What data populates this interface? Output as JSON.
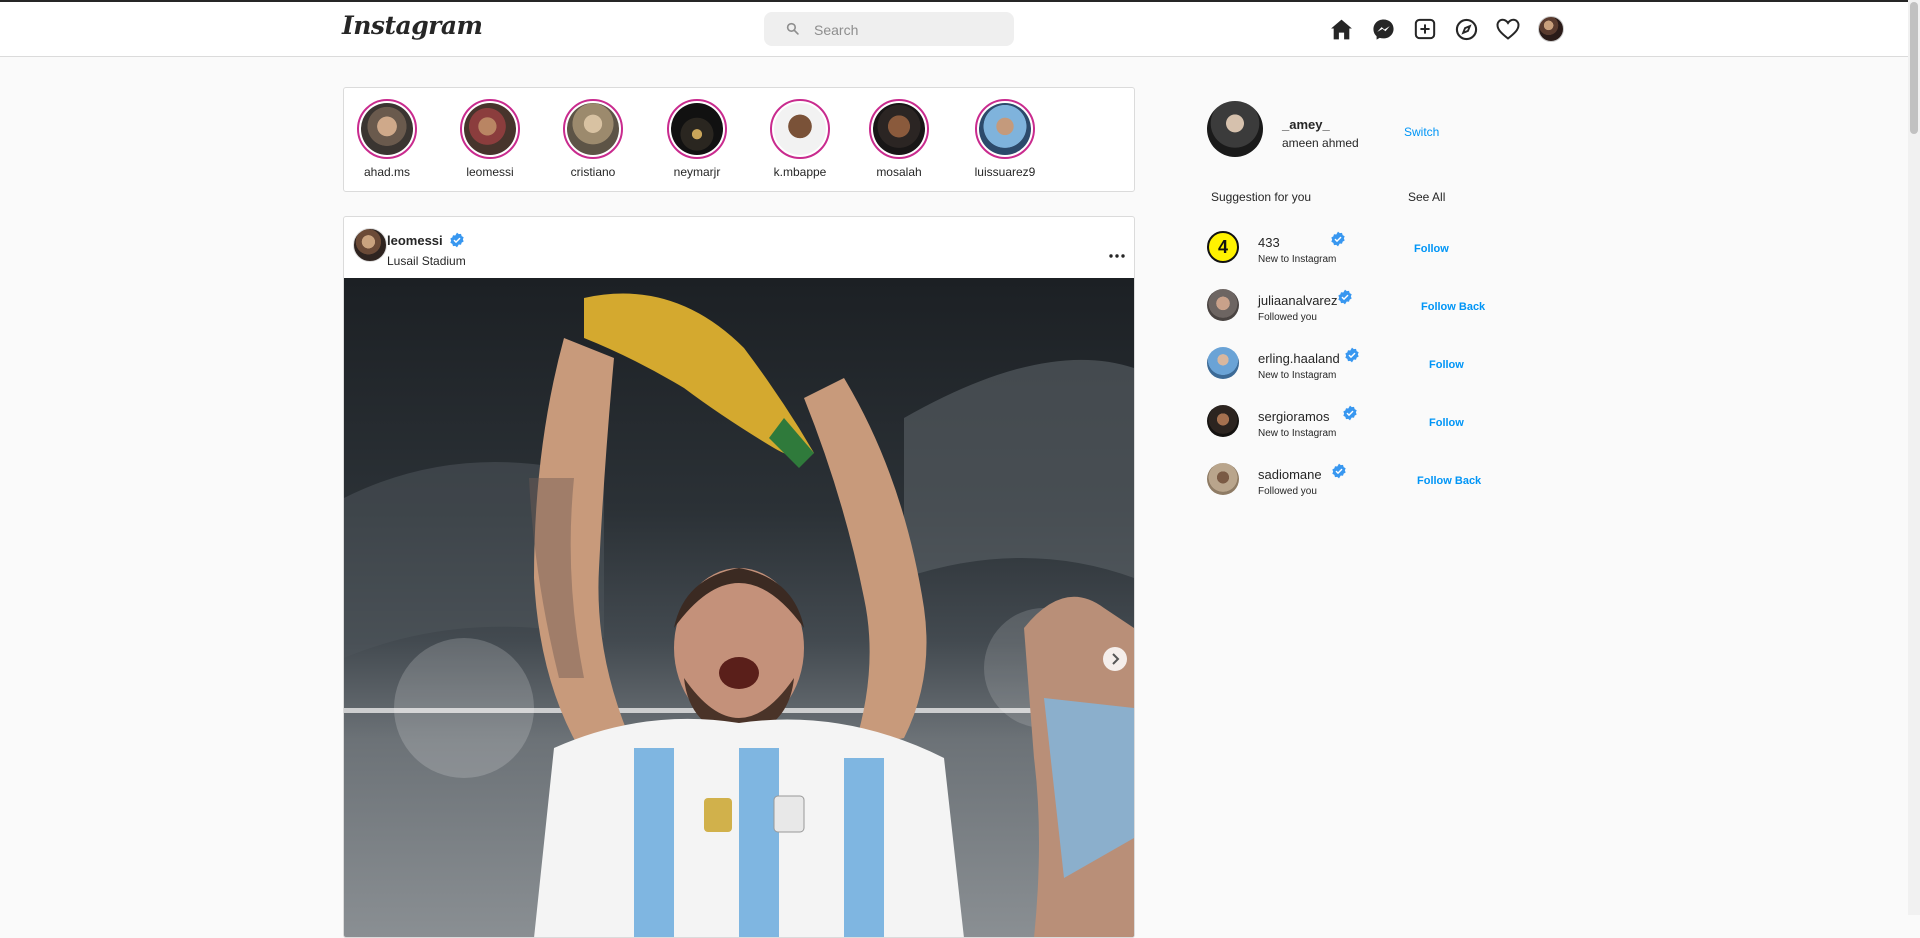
{
  "app": {
    "logo_text": "Instagram"
  },
  "search": {
    "placeholder": "Search"
  },
  "nav": {
    "icons": [
      "home-icon",
      "messenger-icon",
      "new-post-icon",
      "explore-icon",
      "activity-heart-icon",
      "profile-avatar"
    ]
  },
  "stories": [
    {
      "username": "ahad.ms"
    },
    {
      "username": "leomessi"
    },
    {
      "username": "cristiano"
    },
    {
      "username": "neymarjr"
    },
    {
      "username": "k.mbappe"
    },
    {
      "username": "mosalah"
    },
    {
      "username": "luissuarez9"
    }
  ],
  "post": {
    "username": "leomessi",
    "location": "Lusail Stadium",
    "verified": true
  },
  "profile": {
    "username": "_amey_",
    "full_name": "ameen ahmed",
    "switch_label": "Switch"
  },
  "suggestions": {
    "title": "Suggestion for you",
    "see_all_label": "See All",
    "items": [
      {
        "username": "433",
        "subtitle": "New to Instagram",
        "action": "Follow",
        "verified": true,
        "avatar_text": "4"
      },
      {
        "username": "juliaanalvarez",
        "subtitle": "Followed you",
        "action": "Follow Back",
        "verified": true
      },
      {
        "username": "erling.haaland",
        "subtitle": "New to Instagram",
        "action": "Follow",
        "verified": true
      },
      {
        "username": "sergioramos",
        "subtitle": "New to Instagram",
        "action": "Follow",
        "verified": true
      },
      {
        "username": "sadiomane",
        "subtitle": "Followed you",
        "action": "Follow Back",
        "verified": true
      }
    ]
  },
  "colors": {
    "accent": "#0095f6",
    "story_ring": "#c92b8e",
    "verified": "#3897f0"
  }
}
